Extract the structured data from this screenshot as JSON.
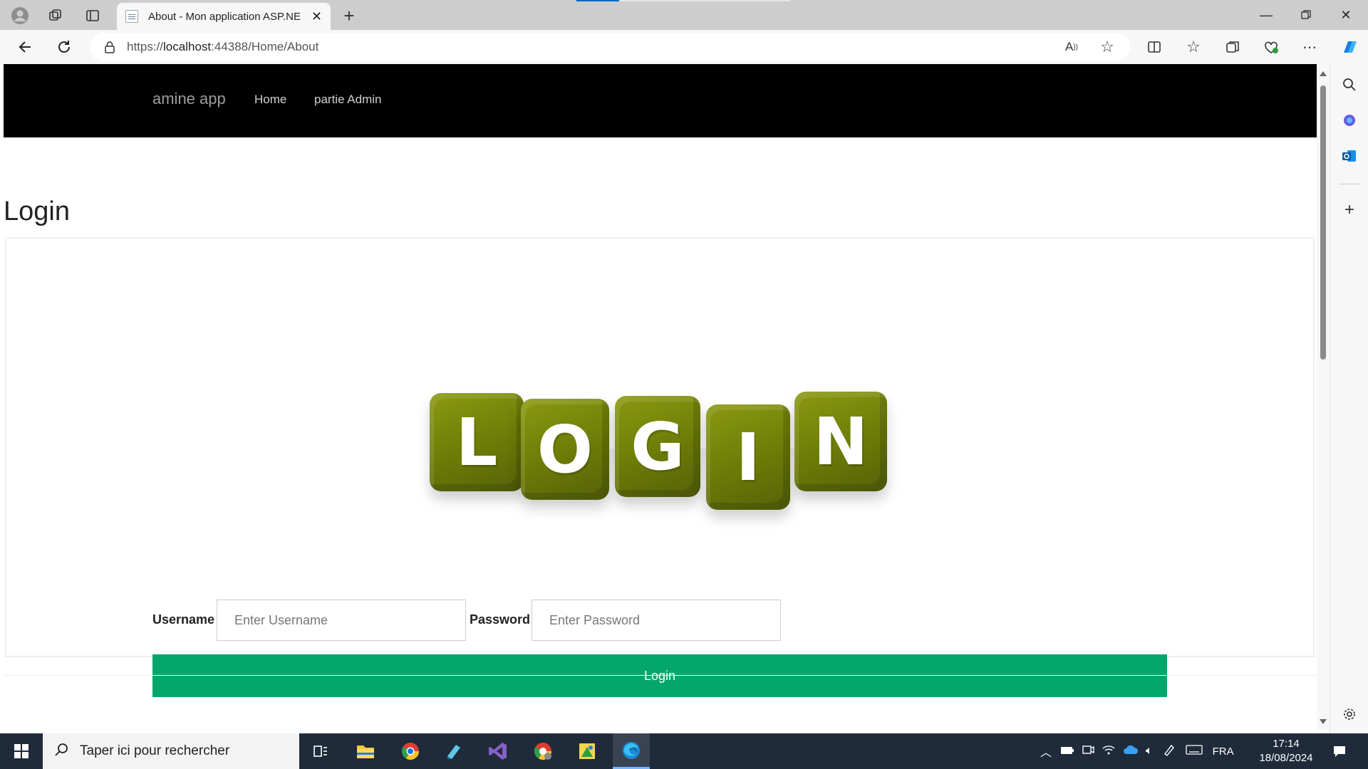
{
  "browser": {
    "tab_title": "About - Mon application ASP.NE",
    "url_prefix": "https://",
    "url_host": "localhost",
    "url_rest": ":44388/Home/About",
    "window_controls": [
      "minimize",
      "restore",
      "close"
    ]
  },
  "navbar": {
    "brand": "amine app",
    "links": [
      "Home",
      "partie Admin"
    ]
  },
  "page": {
    "title": "Login",
    "logo_letters": [
      "L",
      "O",
      "G",
      "I",
      "N"
    ]
  },
  "form": {
    "username_label": "Username",
    "username_placeholder": "Enter Username",
    "password_label": "Password",
    "password_placeholder": "Enter Password",
    "submit_label": "Login"
  },
  "taskbar": {
    "search_placeholder": "Taper ici pour rechercher",
    "language": "FRA",
    "time": "17:14",
    "date": "18/08/2024"
  },
  "colors": {
    "navbar_bg": "#000000",
    "button_green": "#05a66b",
    "cube_olive": "#6c7b06"
  }
}
